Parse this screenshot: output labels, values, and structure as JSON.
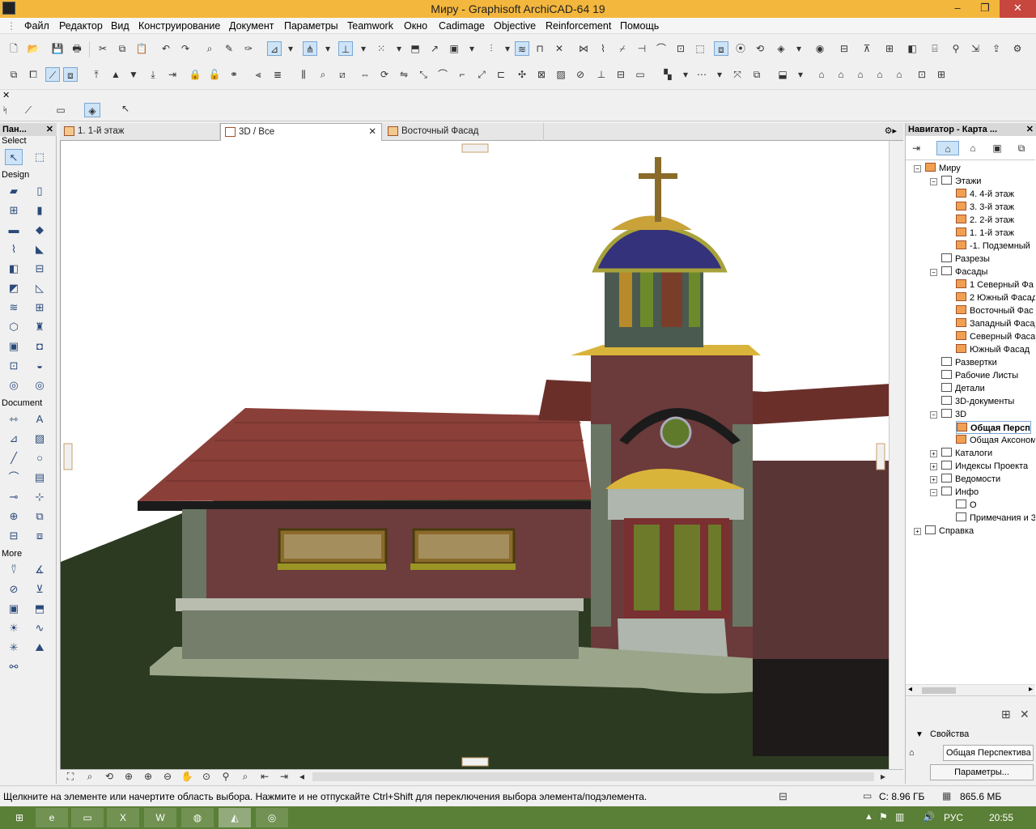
{
  "window": {
    "title": "Миру - Graphisoft ArchiCAD-64 19"
  },
  "menu": [
    "Файл",
    "Редактор",
    "Вид",
    "Конструирование",
    "Документ",
    "Параметры",
    "Teamwork",
    "Окно",
    "Cadimage",
    "Objective",
    "Reinforcement",
    "Помощь"
  ],
  "toolbox": {
    "title": "Пан...",
    "sections": {
      "select": "Select",
      "design": "Design",
      "document": "Document",
      "more": "More"
    }
  },
  "tabs": [
    {
      "label": "1. 1-й этаж"
    },
    {
      "label": "3D / Все",
      "active": true
    },
    {
      "label": "Восточный Фасад"
    }
  ],
  "navigator": {
    "title": "Навигатор - Карта ...",
    "tree": [
      {
        "label": "Миру"
      },
      {
        "label": "Этажи"
      },
      {
        "label": "4. 4-й этаж"
      },
      {
        "label": "3. 3-й этаж"
      },
      {
        "label": "2. 2-й этаж"
      },
      {
        "label": "1. 1-й этаж"
      },
      {
        "label": "-1. Подземный"
      },
      {
        "label": "Разрезы"
      },
      {
        "label": "Фасады"
      },
      {
        "label": "1 Северный Фа"
      },
      {
        "label": "2 Южный Фасад"
      },
      {
        "label": "Восточный Фас"
      },
      {
        "label": "Западный Фасад"
      },
      {
        "label": "Северный Фаса"
      },
      {
        "label": "Южный Фасад"
      },
      {
        "label": "Развертки"
      },
      {
        "label": "Рабочие Листы"
      },
      {
        "label": "Детали"
      },
      {
        "label": "3D-документы"
      },
      {
        "label": "3D"
      },
      {
        "label": "Общая Персп"
      },
      {
        "label": "Общая Аксоном"
      },
      {
        "label": "Каталоги"
      },
      {
        "label": "Индексы Проекта"
      },
      {
        "label": "Ведомости"
      },
      {
        "label": "Инфо"
      },
      {
        "label": "О"
      },
      {
        "label": "Примечания и З"
      },
      {
        "label": "Справка"
      }
    ],
    "properties_label": "Свойства",
    "properties_value": "Общая Перспектива",
    "params_button": "Параметры..."
  },
  "status": {
    "hint": "Щелкните на элементе или начертите область выбора. Нажмите и не отпускайте Ctrl+Shift для переключения выбора элемента/подэлемента.",
    "disk": "C: 8.96 ГБ",
    "memory": "865.6 МБ"
  },
  "taskbar": {
    "lang": "РУС",
    "time": "20:55"
  },
  "colors": {
    "titlebar": "#f3b73e",
    "taskbar": "#5a7f36",
    "close": "#c7463d",
    "roof": "#8a3f38",
    "wall": "#6d3d3d",
    "grass": "#2d3a22"
  }
}
